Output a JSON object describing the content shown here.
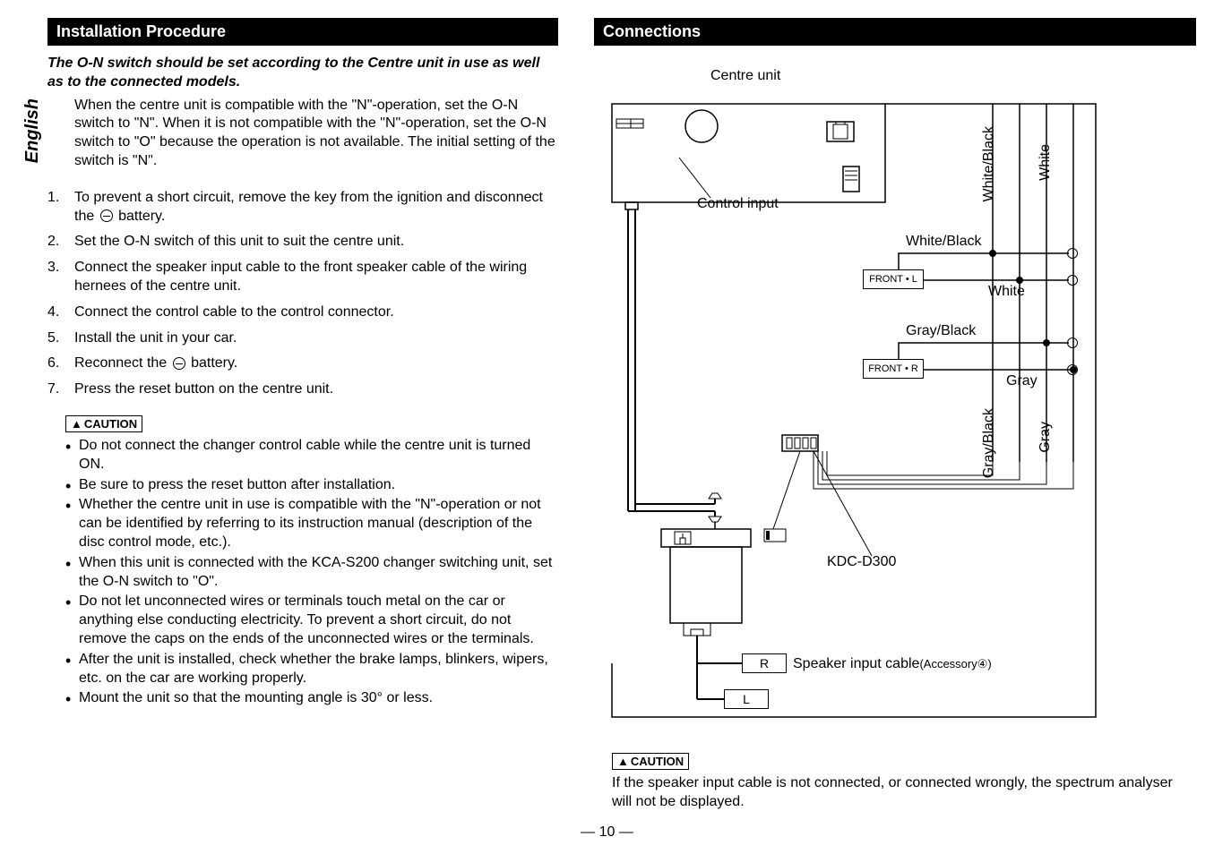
{
  "language": "English",
  "left": {
    "header": "Installation Procedure",
    "intro_bold": "The O-N switch should be set according to the Centre unit in use as well as to the connected models.",
    "intro_desc": "When the centre unit is compatible with the \"N\"-operation, set the O-N switch to \"N\". When it is not compatible with the \"N\"-operation, set the O-N switch to \"O\" because the operation is not available. The initial setting of the switch is \"N\".",
    "steps": [
      "To prevent a short circuit, remove the key from the ignition and disconnect the ⊖ battery.",
      "Set the O-N switch of this unit to suit the centre unit.",
      "Connect the speaker input cable to the front speaker cable of the wiring hernees of the centre unit.",
      "Connect the control cable to the control connector.",
      "Install the unit in your car.",
      "Reconnect the ⊖ battery.",
      "Press the reset button on the centre unit."
    ],
    "caution_label": "CAUTION",
    "cautions": [
      "Do not connect the changer control cable while the centre unit is turned ON.",
      "Be sure to press the reset button after installation.",
      "Whether the centre unit in use is compatible with the \"N\"-operation or not can be identified by referring to its instruction manual (description of the disc control mode, etc.).",
      "When this unit is connected with the KCA-S200 changer switching unit, set the O-N switch to \"O\".",
      "Do not let unconnected wires or terminals touch metal on the car or anything else conducting electricity. To prevent a short circuit, do not remove the caps on the ends of the unconnected wires or the terminals.",
      "After the unit is installed, check whether the brake lamps, blinkers, wipers, etc. on the car are working properly.",
      "Mount the unit so that the mounting angle is 30° or less."
    ]
  },
  "right": {
    "header": "Connections",
    "labels": {
      "centre_unit": "Centre unit",
      "control_input": "Control input",
      "white_black_v": "White/Black",
      "white_v": "White",
      "gray_black_v": "Gray/Black",
      "gray_v": "Gray",
      "white_black_h": "White/Black",
      "white_h": "White",
      "gray_black_h": "Gray/Black",
      "gray_h": "Gray",
      "front_l": "FRONT • L",
      "front_r": "FRONT • R",
      "kdc": "KDC-D300",
      "r": "R",
      "l": "L",
      "speaker_cable": "Speaker input cable",
      "accessory": "(Accessory④)"
    },
    "caution_label": "CAUTION",
    "caution_text": "If the speaker input cable is not connected, or connected wrongly, the spectrum analyser will not be displayed."
  },
  "page_number": "— 10 —"
}
